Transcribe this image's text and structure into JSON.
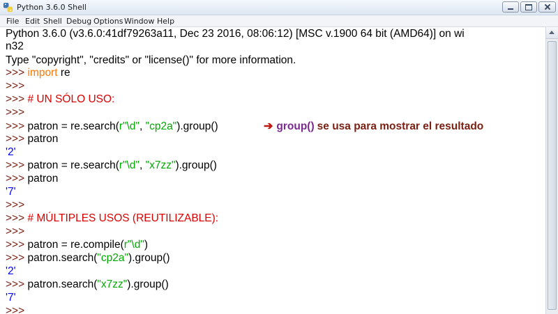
{
  "window": {
    "title": "Python 3.6.0 Shell",
    "icon": "python-icon"
  },
  "menu": {
    "file": "File",
    "edit": "Edit",
    "shell": "Shell",
    "debug": "Debug",
    "options": "Options",
    "window": "Window",
    "help": "Help"
  },
  "shell": {
    "prompt": ">>>",
    "lines": {
      "header1": "Python 3.6.0 (v3.6.0:41df79263a11, Dec 23 2016, 08:06:12) [MSC v.1900 64 bit (AMD64)] on wi",
      "header2": "n32",
      "header3": "Type \"copyright\", \"credits\" or \"license()\" for more information.",
      "l4_kw": "import",
      "l4_rest": " re",
      "l7_comment": "# UN SÓLO USO:",
      "l9_a": "patron = re.search(",
      "l9_s1": "r\"\\d\"",
      "l9_b": ", ",
      "l9_s2": "\"cp2a\"",
      "l9_c": ").group()",
      "l10": "patron",
      "l11_out": "'2'",
      "l12_a": "patron = re.search(",
      "l12_s1": "r\"\\d\"",
      "l12_b": ", ",
      "l12_s2": "\"x7zz\"",
      "l12_c": ").group()",
      "l13": "patron",
      "l14_out": "'7'",
      "l16_comment": "# MÚLTIPLES USOS (REUTILIZABLE):",
      "l18_a": "patron = re.compile(",
      "l18_s1": "r\"\\d\"",
      "l18_c": ")",
      "l19_a": "patron.search(",
      "l19_s1": "\"cp2a\"",
      "l19_c": ").group()",
      "l20_out": "'2'",
      "l21_a": "patron.search(",
      "l21_s1": "\"x7zz\"",
      "l21_c": ").group()",
      "l22_out": "'7'"
    }
  },
  "annotation": {
    "arrow": "➔",
    "func": "group()",
    "text": "se usa para mostrar el resultado"
  },
  "colors": {
    "prompt": "#7a1f12",
    "keyword": "#ff7700",
    "string": "#00aa00",
    "comment": "#dd0000",
    "output": "#0000ff",
    "annotation_arrow": "#c0170f",
    "annotation_func": "#7b2a8f",
    "annotation_text": "#7a1f12"
  }
}
